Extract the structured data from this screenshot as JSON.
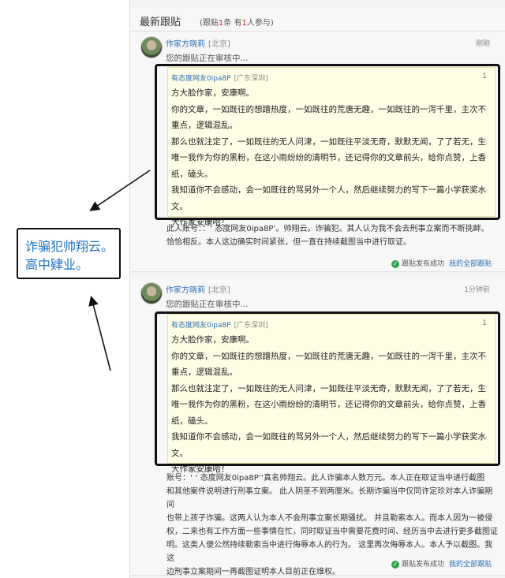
{
  "header": {
    "title": "最新跟贴",
    "sub_prefix": "(跟贴",
    "count": "1",
    "sub_mid": "条 有",
    "participants": "1",
    "sub_suffix": "人参与)"
  },
  "posts": [
    {
      "author": "作家方晓莉",
      "location": "[北京]",
      "time": "刚刚",
      "review": "您的跟贴正在审核中...",
      "quote": {
        "author": "有态度网友0ipa8P",
        "location": "[广东深圳]",
        "floor": "1",
        "lines": [
          "方大脸作家，安康啊。",
          "你的文章，一如既往的想蹭热度，一如既往的荒唐无趣，一如既往的一泻千里，主次不分，没有",
          "重点，逻辑混乱。",
          "那么也就注定了，一如既往的无人问津，一如既往平淡无奇，默默无闻，了了若无，生老病死。",
          "唯一我作为你的黑粉，在这小雨纷纷的清明节，还记得你的文章前头，给你点赞，上香，烧黄",
          "纸，磕头。",
          "我知道你不会感动，会一如既往的骂另外一个人，然后继续努力的写下一篇小学获奖水平的作",
          "文。",
          "大作家安康哈！"
        ]
      },
      "note_lines": [
        "此人账号：：‘ 态度网友0ipa8P’。帅翔云。诈骗犯。其人认为我不会去刑事立案而不断挑衅。",
        "恰恰相反。本人这边确实时间紧张，但一直在持续截图当中进行取证。"
      ],
      "status": "跟贴发布成功",
      "link": "我的全部跟贴"
    },
    {
      "author": "作家方晓莉",
      "location": "[北京]",
      "time": "1分钟前",
      "review": "您的跟贴正在审核中...",
      "quote": {
        "author": "有态度网友0ipa8P",
        "location": "[广东深圳]",
        "floor": "1",
        "lines": [
          "方大脸作家，安康啊。",
          "你的文章，一如既往的想蹭热度，一如既往的荒唐无趣，一如既往的一泻千里，主次不分，没有",
          "重点，逻辑混乱。",
          "那么也就注定了，一如既往的无人问津，一如既往平淡无奇，默默无闻，了了若无，生老病死。",
          "唯一我作为你的黑粉，在这小雨纷纷的清明节，还记得你的文章前头，给你点赞，上香，烧黄",
          "纸，磕头。",
          "我知道你不会感动，会一如既往的骂另外一个人，然后继续努力的写下一篇小学获奖水平的作",
          "文。",
          "大作家安康哈！"
        ]
      },
      "note_lines": [
        "账号：‘ ‘ 态度网友0ipa8P’’真名帅翔云。此人诈骗本人数万元。本人正在取证当中进行截图",
        "和其他案件说明进行刑事立案。 此人阴茎不到两厘米。长期诈骗当中仅同许定珍对本人诈骗期间",
        "也带上孩子诈骗。这两人认为本人不会刑事立案长期骚扰。 并且勒索本人。而本人因为一被侵",
        "权，二来也有工作方面一些事情在忙，同时取证当中需要花费时间、经历当中去进行更多截图证",
        "明。这类人便公然持续勒索当中进行侮辱本人的行为。 这里再次侮辱本人。本人予以截图。我这",
        "边刑事立案期间一再截图证明本人目前正在维权。"
      ],
      "status": "跟贴发布成功",
      "link": "我的全部跟贴"
    }
  ],
  "callout": {
    "line1": "诈骗犯帅翔云。",
    "line2": "高中肄业。"
  },
  "colors": {
    "link": "#2b6fb6",
    "accent_red": "#d8271c",
    "callout_text": "#1e73c8",
    "quote_bg": "#fefee6",
    "success": "#2fa44f"
  }
}
